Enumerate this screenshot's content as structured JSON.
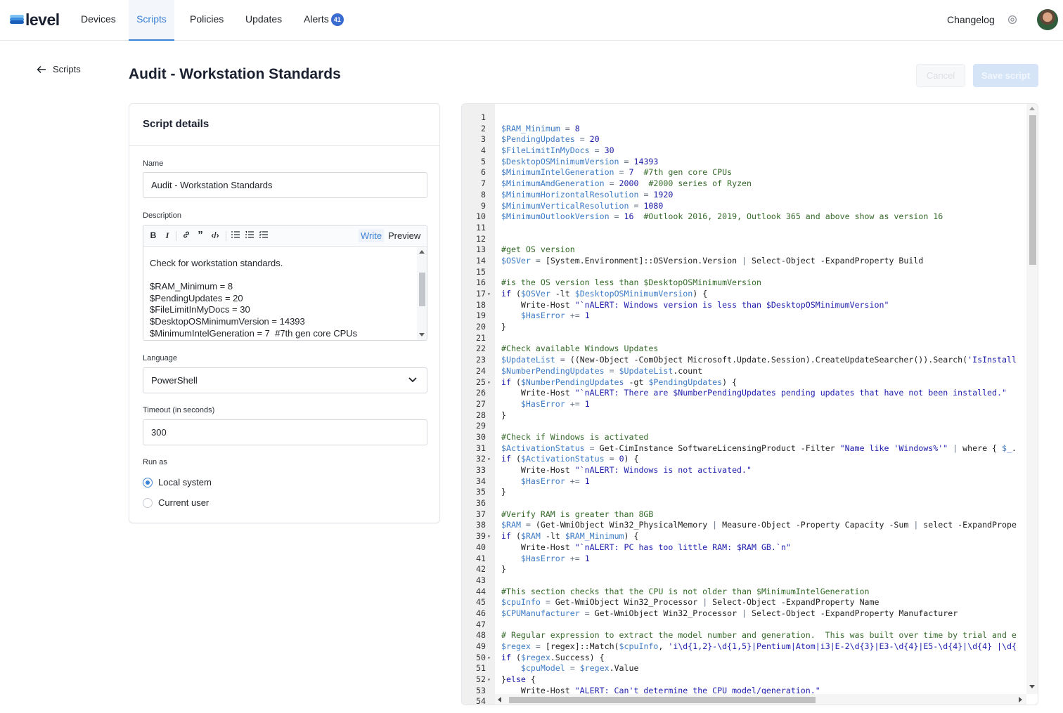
{
  "nav": {
    "logo": "level",
    "items": [
      {
        "label": "Devices"
      },
      {
        "label": "Scripts"
      },
      {
        "label": "Policies"
      },
      {
        "label": "Updates"
      },
      {
        "label": "Alerts",
        "badge": "41"
      }
    ],
    "changelog": "Changelog",
    "gear_icon": "gear-icon",
    "colors": {
      "accent": "#3b82d6",
      "badge": "#3a6bd0"
    }
  },
  "header": {
    "back_label": "Scripts",
    "title": "Audit - Workstation Standards",
    "cancel_label": "Cancel",
    "save_label": "Save script"
  },
  "details": {
    "title": "Script details",
    "name_label": "Name",
    "name_value": "Audit - Workstation Standards",
    "description_label": "Description",
    "write_tab": "Write",
    "preview_tab": "Preview",
    "toolbar_icons": [
      "bold-icon",
      "italic-icon",
      "link-icon",
      "quote-icon",
      "code-icon",
      "bullet-list-icon",
      "numbered-list-icon",
      "task-list-icon"
    ],
    "description_text": "Check for workstation standards.\n\n$RAM_Minimum = 8\n$PendingUpdates = 20\n$FileLimitInMyDocs = 30\n$DesktopOSMinimumVersion = 14393\n$MinimumIntelGeneration = 7  #7th gen core CPUs",
    "language_label": "Language",
    "language_value": "PowerShell",
    "timeout_label": "Timeout (in seconds)",
    "timeout_value": "300",
    "runas_label": "Run as",
    "runas_options": [
      {
        "label": "Local system",
        "selected": true
      },
      {
        "label": "Current user",
        "selected": false
      }
    ]
  },
  "code": {
    "lines": [
      "",
      "$RAM_Minimum = 8",
      "$PendingUpdates = 20",
      "$FileLimitInMyDocs = 30",
      "$DesktopOSMinimumVersion = 14393",
      "$MinimumIntelGeneration = 7  #7th gen core CPUs",
      "$MinimumAmdGeneration = 2000  #2000 series of Ryzen",
      "$MinimumHorizontalResolution = 1920",
      "$MinimumVerticalResolution = 1080",
      "$MinimumOutlookVersion = 16  #Outlook 2016, 2019, Outlook 365 and above show as version 16",
      "",
      "",
      "#get OS version",
      "$OSVer = [System.Environment]::OSVersion.Version | Select-Object -ExpandProperty Build",
      "",
      "#is the OS version less than $DesktopOSMinimumVersion",
      "if ($OSVer -lt $DesktopOSMinimumVersion) {",
      "    Write-Host \"`nALERT: Windows version is less than $DesktopOSMinimumVersion\"",
      "    $HasError += 1",
      "}",
      "",
      "#Check available Windows Updates",
      "$UpdateList = ((New-Object -ComObject Microsoft.Update.Session).CreateUpdateSearcher()).Search('IsInstall",
      "$NumberPendingUpdates = $UpdateList.count",
      "if ($NumberPendingUpdates -gt $PendingUpdates) {",
      "    Write-Host \"`nALERT: There are $NumberPendingUpdates pending updates that have not been installed.\"",
      "    $HasError += 1",
      "}",
      "",
      "#Check if Windows is activated",
      "$ActivationStatus = Get-CimInstance SoftwareLicensingProduct -Filter \"Name like 'Windows%'\" | where { $_.",
      "if ($ActivationStatus = 0) {",
      "    Write-Host \"`nALERT: Windows is not activated.\"",
      "    $HasError += 1",
      "}",
      "",
      "#Verify RAM is greater than 8GB",
      "$RAM = (Get-WmiObject Win32_PhysicalMemory | Measure-Object -Property Capacity -Sum | select -ExpandPrope",
      "if ($RAM -lt $RAM_Minimum) {",
      "    Write-Host \"`nALERT: PC has too little RAM: $RAM GB.`n\"",
      "    $HasError += 1",
      "}",
      "",
      "#This section checks that the CPU is not older than $MinimumIntelGeneration",
      "$cpuInfo = Get-WmiObject Win32_Processor | Select-Object -ExpandProperty Name",
      "$CPUManufacturer = Get-WmiObject Win32_Processor | Select-Object -ExpandProperty Manufacturer",
      "",
      "# Regular expression to extract the model number and generation.  This was built over time by trial and e",
      "$regex = [regex]::Match($cpuInfo, 'i\\d{1,2}-\\d{1,5}|Pentium|Atom|i3|E-2\\d{3}|E3-\\d{4}|E5-\\d{4}|\\d{4} |\\d{",
      "if ($regex.Success) {",
      "    $cpuModel = $regex.Value",
      "}else {",
      "    Write-Host \"ALERT: Can't determine the CPU model/generation.\"",
      ""
    ],
    "fold_lines": [
      17,
      25,
      32,
      39,
      50,
      52
    ]
  }
}
